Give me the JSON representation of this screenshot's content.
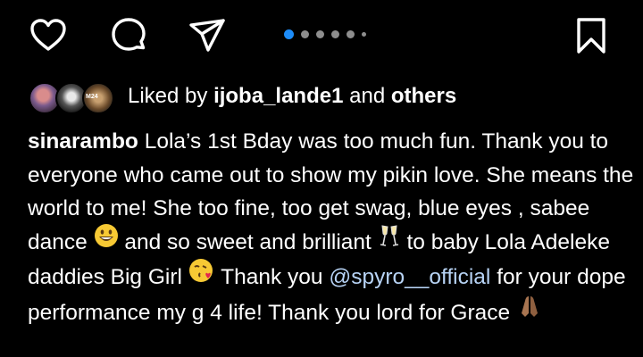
{
  "actions": {
    "like": "heart-icon",
    "comment": "comment-icon",
    "share": "paper-plane-icon",
    "save": "bookmark-icon"
  },
  "carousel": {
    "total_dots_visible": 6,
    "active_index": 0
  },
  "likes": {
    "prefix": "Liked by ",
    "user": "ijoba_lande1",
    "middle": " and ",
    "others": "others",
    "avatar3_text": "M24"
  },
  "caption": {
    "username": "sinarambo",
    "text1": " Lola’s 1st Bday was too much fun. Thank you to everyone who came out to show my pikin love. She means the world to me! She too fine, too get swag, blue eyes , sabee dance ",
    "text2": " and so sweet and brilliant ",
    "text3": " to baby Lola Adeleke daddies Big Girl ",
    "text4": " Thank you ",
    "mention": "@spyro__official",
    "text5": "  for your dope performance my g 4 life! Thank you lord for Grace ",
    "emoji_1": "grinning-face",
    "emoji_2": "champagne-glasses",
    "emoji_3": "face-blowing-kiss",
    "emoji_4": "folded-hands"
  },
  "colors": {
    "background": "#000000",
    "text": "#ffffff",
    "active_dot": "#1d8cf8",
    "inactive_dot": "#8e8e8e",
    "mention": "#b7d3f5"
  }
}
